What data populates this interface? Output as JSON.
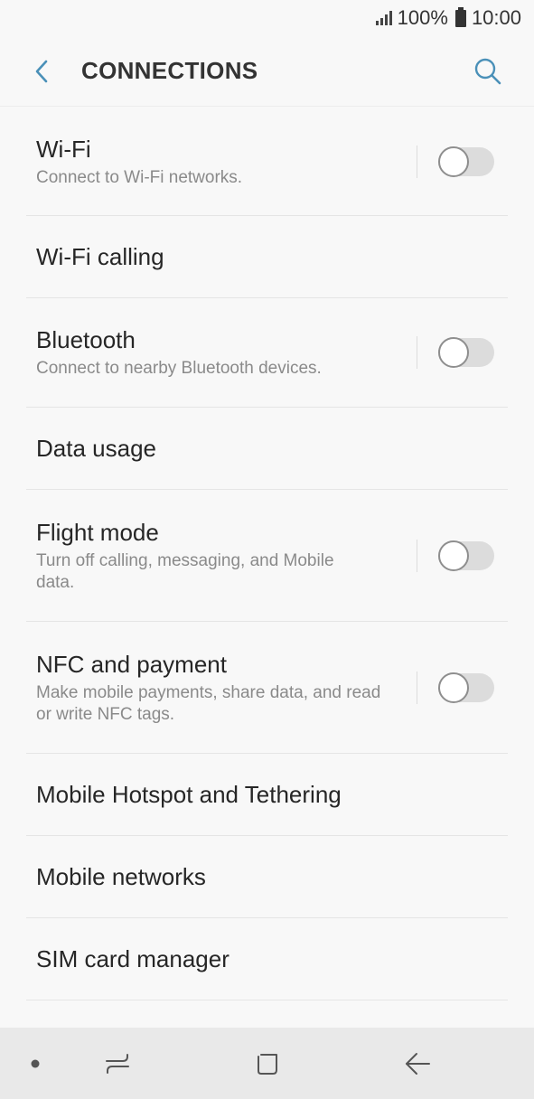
{
  "status_bar": {
    "battery": "100%",
    "time": "10:00",
    "icons": [
      "signal-icon",
      "battery-icon"
    ]
  },
  "app_bar": {
    "title": "CONNECTIONS",
    "back_icon": "chevron-left-icon",
    "search_icon": "search-icon",
    "accent_color": "#4a90b8"
  },
  "settings": [
    {
      "title": "Wi-Fi",
      "subtitle": "Connect to Wi-Fi networks.",
      "toggle": false
    },
    {
      "title": "Wi-Fi calling"
    },
    {
      "title": "Bluetooth",
      "subtitle": "Connect to nearby Bluetooth devices.",
      "toggle": false
    },
    {
      "title": "Data usage"
    },
    {
      "title": "Flight mode",
      "subtitle": "Turn off calling, messaging, and Mobile data.",
      "toggle": false
    },
    {
      "title": "NFC and payment",
      "subtitle": "Make mobile payments, share data, and read or write NFC tags.",
      "toggle": false
    },
    {
      "title": "Mobile Hotspot and Tethering"
    },
    {
      "title": "Mobile networks"
    },
    {
      "title": "SIM card manager"
    }
  ],
  "nav_bar": {
    "icons": [
      "dot-icon",
      "recent-apps-icon",
      "home-icon",
      "back-arrow-icon"
    ]
  }
}
